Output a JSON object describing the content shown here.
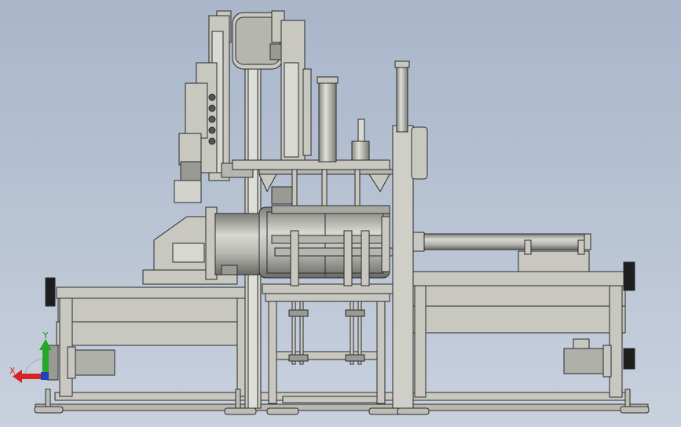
{
  "window": {
    "title": ""
  },
  "triad": {
    "x_label": "X",
    "y_label": "Y",
    "x_color": "#d42424",
    "y_color": "#22a022",
    "z_color": "#2040c0"
  },
  "colors": {
    "background_top": "#a9b6ca",
    "background_bottom": "#c9d1de",
    "part_fill": "#c8c8c0",
    "part_stroke": "#2a2a2a",
    "part_dark": "#9a9a94"
  }
}
